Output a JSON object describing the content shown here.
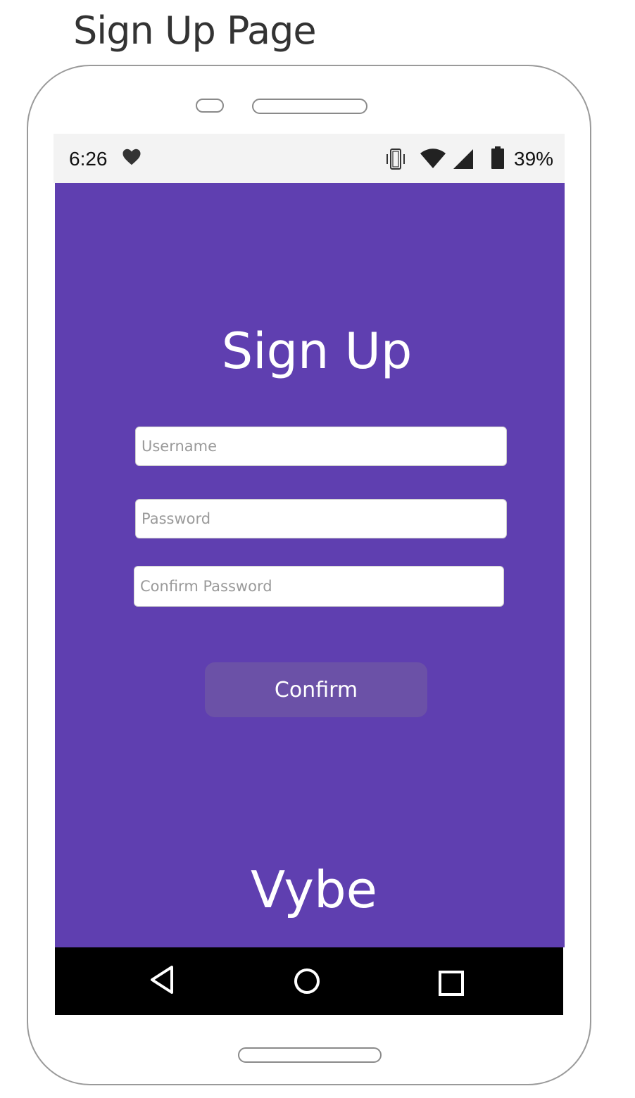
{
  "caption": "Sign Up Page",
  "status_bar": {
    "time": "6:26",
    "battery_percent": "39%",
    "icons": [
      "heart-icon",
      "vibrate-icon",
      "wifi-icon",
      "signal-icon",
      "battery-icon"
    ]
  },
  "form": {
    "title": "Sign Up",
    "username_placeholder": "Username",
    "password_placeholder": "Password",
    "confirm_password_placeholder": "Confirm Password",
    "confirm_label": "Confirm"
  },
  "brand": "Vybe",
  "nav": {
    "icons": [
      "back-icon",
      "home-icon",
      "recent-apps-icon"
    ]
  },
  "colors": {
    "background": "#5f3fb0",
    "button": "#6b51a7",
    "status_bar": "#f3f3f3",
    "nav_bar": "#000000"
  }
}
